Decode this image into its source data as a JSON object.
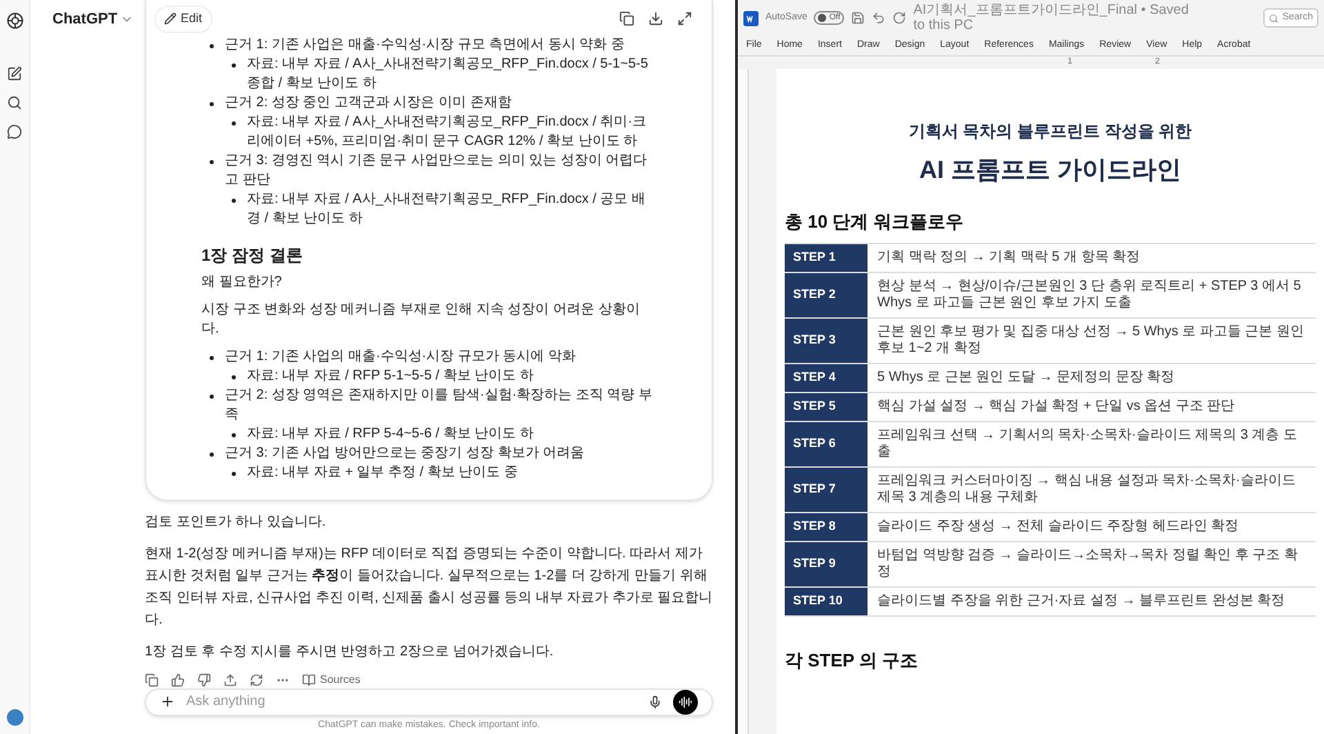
{
  "chat": {
    "model_label": "ChatGPT",
    "canvas": {
      "edit_label": "Edit",
      "blocks": [
        {
          "kind": "list",
          "items": [
            {
              "text": "근거 1: 기존 사업은 매출·수익성·시장 규모 측면에서 동시 약화 중",
              "children": [
                {
                  "text": "자료: 내부 자료 / A사_사내전략기획공모_RFP_Fin.docx / 5-1~5-5 종합 / 확보 난이도 하"
                }
              ]
            },
            {
              "text": "근거 2: 성장 중인 고객군과 시장은 이미 존재함",
              "children": [
                {
                  "text": "자료: 내부 자료 / A사_사내전략기획공모_RFP_Fin.docx / 취미·크리에이터 +5%, 프리미엄·취미 문구 CAGR 12% / 확보 난이도 하"
                }
              ]
            },
            {
              "text": "근거 3: 경영진 역시 기존 문구 사업만으로는 의미 있는 성장이 어렵다고 판단",
              "children": [
                {
                  "text": "자료: 내부 자료 / A사_사내전략기획공모_RFP_Fin.docx / 공모 배경 / 확보 난이도 하"
                }
              ]
            }
          ]
        },
        {
          "kind": "heading",
          "text": "1장 잠정 결론"
        },
        {
          "kind": "paragraph",
          "text": "왜 필요한가?"
        },
        {
          "kind": "paragraph",
          "text": "시장 구조 변화와 성장 메커니즘 부재로 인해 지속 성장이 어려운 상황이다."
        },
        {
          "kind": "list",
          "items": [
            {
              "text": "근거 1: 기존 사업의 매출·수익성·시장 규모가 동시에 악화",
              "children": [
                {
                  "text": "자료: 내부 자료 / RFP 5-1~5-5 / 확보 난이도 하"
                }
              ]
            },
            {
              "text": "근거 2: 성장 영역은 존재하지만 이를 탐색·실험·확장하는 조직 역량 부족",
              "children": [
                {
                  "text": "자료: 내부 자료 / RFP 5-4~5-6 / 확보 난이도 하"
                }
              ]
            },
            {
              "text": "근거 3: 기존 사업 방어만으로는 중장기 성장 확보가 어려움",
              "children": [
                {
                  "text": "자료: 내부 자료 + 일부 추정 / 확보 난이도 중"
                }
              ]
            }
          ]
        }
      ]
    },
    "messages": [
      "검토 포인트가 하나 있습니다.",
      "현재 1-2(성장 메커니즘 부재)는 RFP 데이터로 직접 증명되는 수준이 약합니다. 따라서 제가 표시한 것처럼 일부 근거는 **추정**이 들어갔습니다. 실무적으로는 1-2를 더 강하게 만들기 위해 조직 인터뷰 자료, 신규사업 추진 이력, 신제품 출시 성공률 등의 내부 자료가 추가로 필요합니다.",
      "1장 검토 후 수정 지시를 주시면 반영하고 2장으로 넘어가겠습니다."
    ],
    "sources_label": "Sources",
    "composer": {
      "placeholder": "Ask anything"
    },
    "disclaimer": "ChatGPT can make mistakes. Check important info."
  },
  "word": {
    "autosave_label": "AutoSave",
    "autosave_on": false,
    "autosave_state_label": "Off",
    "doc_title": "AI기획서_프롬프트가이드라인_Final • Saved to this PC",
    "search_placeholder": "Search",
    "menu": [
      "File",
      "Home",
      "Insert",
      "Draw",
      "Design",
      "Layout",
      "References",
      "Mailings",
      "Review",
      "View",
      "Help",
      "Acrobat"
    ],
    "ruler_labels": [
      "1",
      "2"
    ],
    "document": {
      "subtitle": "기획서 목차의 블루프린트 작성을 위한",
      "title": "AI 프롬프트 가이드라인",
      "section_heading": "총 10 단계 워크플로우",
      "steps": [
        {
          "label": "STEP 1",
          "text": "기획 맥락 정의 → 기획 맥락 5 개 항목 확정"
        },
        {
          "label": "STEP 2",
          "text": "현상 분석 → 현상/이슈/근본원인 3 단 층위 로직트리 + STEP 3 에서 5 Whys 로 파고들 근본 원인 후보 가지 도출"
        },
        {
          "label": "STEP 3",
          "text": "근본 원인 후보 평가 및 집중 대상 선정 → 5 Whys 로 파고들 근본 원인 후보 1~2 개 확정"
        },
        {
          "label": "STEP 4",
          "text": "5 Whys 로 근본 원인 도달 → 문제정의 문장 확정"
        },
        {
          "label": "STEP 5",
          "text": "핵심 가설 설정 → 핵심 가설 확정 + 단일 vs 옵션 구조 판단"
        },
        {
          "label": "STEP 6",
          "text": "프레임워크 선택 → 기획서의 목차·소목차·슬라이드 제목의 3 계층 도출"
        },
        {
          "label": "STEP 7",
          "text": "프레임워크 커스터마이징 → 핵심 내용 설정과 목차·소목차·슬라이드 제목 3 계층의 내용 구체화"
        },
        {
          "label": "STEP 8",
          "text": "슬라이드 주장 생성 → 전체 슬라이드 주장형 헤드라인 확정"
        },
        {
          "label": "STEP 9",
          "text": "바텀업 역방향 검증 → 슬라이드→소목차→목차 정렬 확인 후 구조 확정"
        },
        {
          "label": "STEP 10",
          "text": "슬라이드별 주장을 위한 근거·자료 설정 → 블루프린트 완성본 확정"
        }
      ],
      "next_heading": "각 STEP 의 구조"
    }
  }
}
